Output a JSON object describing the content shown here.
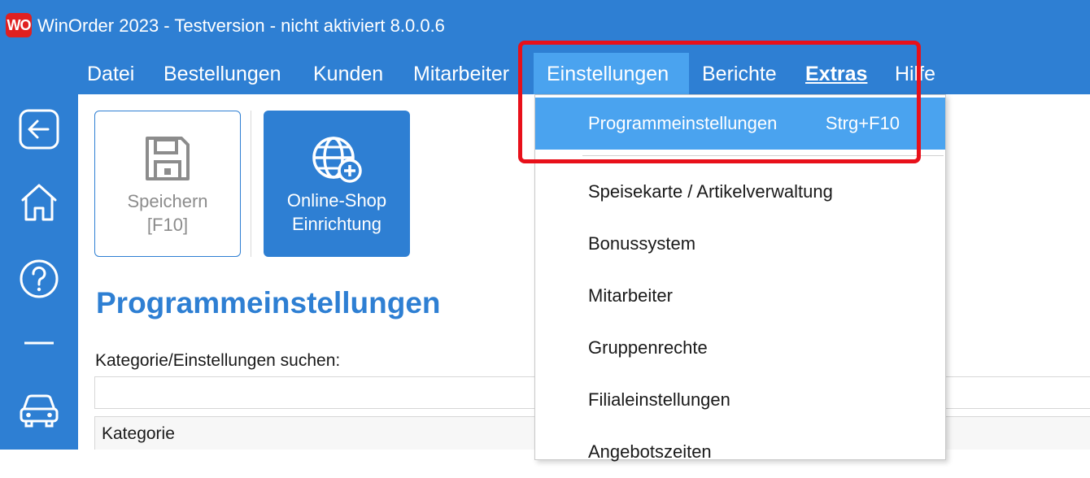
{
  "window": {
    "logo_text": "WO",
    "title": "WinOrder 2023 - Testversion - nicht aktiviert 8.0.0.6"
  },
  "menubar": {
    "items": [
      {
        "label": "Datei"
      },
      {
        "label": "Bestellungen"
      },
      {
        "label": "Kunden"
      },
      {
        "label": "Mitarbeiter"
      },
      {
        "label": "Einstellungen",
        "active": true
      },
      {
        "label": "Berichte"
      },
      {
        "label": "Extras",
        "bold": true
      },
      {
        "label": "Hilfe"
      }
    ]
  },
  "sidebar": {
    "icons": [
      "back-icon",
      "home-icon",
      "help-icon",
      "minimize-icon",
      "car-icon"
    ]
  },
  "toolbar": {
    "save_label": "Speichern\n[F10]",
    "shop_label": "Online-Shop\nEinrichtung"
  },
  "main": {
    "page_title": "Programmeinstellungen",
    "search_label": "Kategorie/Einstellungen suchen:",
    "search_value": "",
    "table_header": "Kategorie"
  },
  "dropdown": {
    "items": [
      {
        "label": "Programmeinstellungen",
        "shortcut": "Strg+F10",
        "highlighted": true
      },
      {
        "label": "Speisekarte / Artikelverwaltung"
      },
      {
        "label": "Bonussystem"
      },
      {
        "label": "Mitarbeiter"
      },
      {
        "label": "Gruppenrechte"
      },
      {
        "label": "Filialeinstellungen"
      },
      {
        "label": "Angebotszeiten"
      }
    ]
  },
  "colors": {
    "primary": "#2e7fd3",
    "menu_active": "#4aa3ef",
    "highlight_frame": "#e8101a",
    "logo": "#e02020"
  }
}
